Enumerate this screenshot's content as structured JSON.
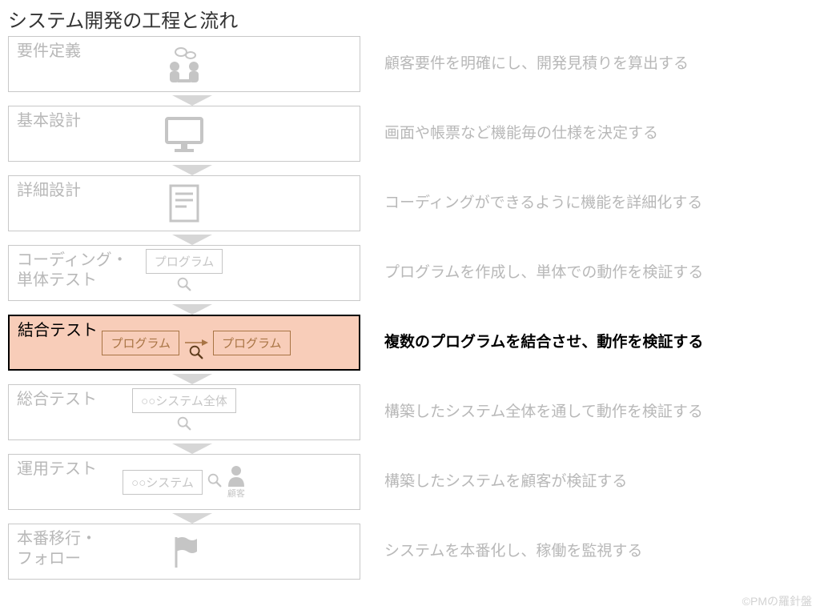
{
  "title": "システム開発の工程と流れ",
  "footer": "©PMの羅針盤",
  "labels": {
    "program": "プログラム",
    "system_whole": "○○システム全体",
    "system": "○○システム",
    "customer": "顧客"
  },
  "stages": [
    {
      "name": "要件定義",
      "desc": "顧客要件を明確にし、開発見積りを算出する",
      "icon": "meeting",
      "hi": false
    },
    {
      "name": "基本設計",
      "desc": "画面や帳票など機能毎の仕様を決定する",
      "icon": "monitor",
      "hi": false
    },
    {
      "name": "詳細設計",
      "desc": "コーディングができるように機能を詳細化する",
      "icon": "doc",
      "hi": false
    },
    {
      "name": "コーディング・\n単体テスト",
      "desc": "プログラムを作成し、単体での動作を検証する",
      "icon": "ut",
      "hi": false
    },
    {
      "name": "結合テスト",
      "desc": "複数のプログラムを結合させ、動作を検証する",
      "icon": "it",
      "hi": true
    },
    {
      "name": "総合テスト",
      "desc": "構築したシステム全体を通して動作を検証する",
      "icon": "st",
      "hi": false
    },
    {
      "name": "運用テスト",
      "desc": "構築したシステムを顧客が検証する",
      "icon": "uat",
      "hi": false
    },
    {
      "name": "本番移行・\nフォロー",
      "desc": "システムを本番化し、稼働を監視する",
      "icon": "flag",
      "hi": false
    }
  ]
}
